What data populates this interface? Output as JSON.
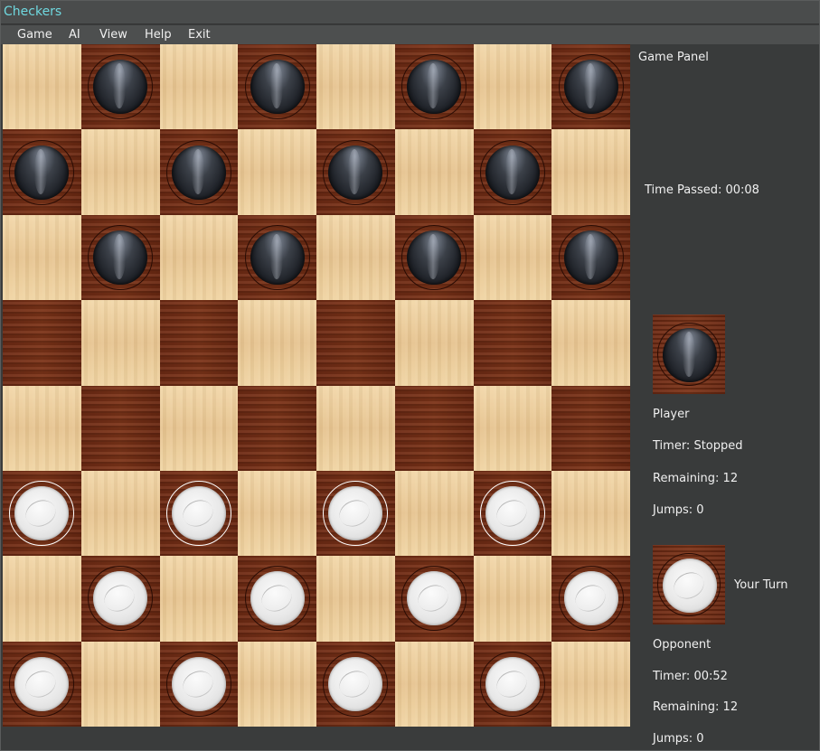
{
  "window": {
    "title": "Checkers"
  },
  "menu": [
    {
      "label": "Game"
    },
    {
      "label": "AI"
    },
    {
      "label": "View"
    },
    {
      "label": "Help"
    },
    {
      "label": "Exit"
    }
  ],
  "board": {
    "rows": [
      [
        "",
        "B",
        "",
        "B",
        "",
        "B",
        "",
        "B"
      ],
      [
        "B",
        "",
        "B",
        "",
        "B",
        "",
        "B",
        ""
      ],
      [
        "",
        "B",
        "",
        "B",
        "",
        "B",
        "",
        "B"
      ],
      [
        "",
        "",
        "",
        "",
        "",
        "",
        "",
        ""
      ],
      [
        "",
        "",
        "",
        "",
        "",
        "",
        "",
        ""
      ],
      [
        "W*",
        "",
        "W*",
        "",
        "W*",
        "",
        "W*",
        ""
      ],
      [
        "",
        "W",
        "",
        "W",
        "",
        "W",
        "",
        "W"
      ],
      [
        "W",
        "",
        "W",
        "",
        "W",
        "",
        "W",
        ""
      ]
    ],
    "colors": {
      "light": "#e9c894",
      "dark": "#722d15",
      "highlight": "#ffffff"
    }
  },
  "panel": {
    "heading": "Game Panel",
    "time_passed": "Time Passed: 00:08",
    "player": {
      "label": "Player",
      "timer": "Timer: Stopped",
      "remaining": "Remaining: 12",
      "jumps": "Jumps: 0"
    },
    "opponent": {
      "turn_status": "Your Turn",
      "label": "Opponent",
      "timer": "Timer: 00:52",
      "remaining": "Remaining: 12",
      "jumps": "Jumps: 0"
    }
  }
}
